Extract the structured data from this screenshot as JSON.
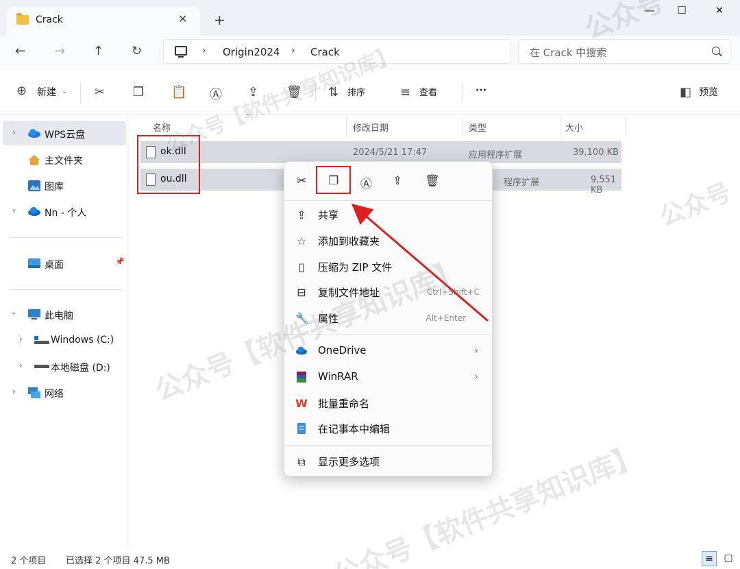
{
  "window": {
    "tab_title": "Crack",
    "tab_close": "✕",
    "new_tab": "+",
    "minimize": "—",
    "maximize": "☐",
    "close": "✕"
  },
  "nav": {
    "back": "←",
    "forward": "→",
    "up": "↑",
    "refresh": "↻"
  },
  "breadcrumb": [
    "Origin2024",
    "Crack"
  ],
  "breadcrumb_sep": "›",
  "search": {
    "placeholder": "在 Crack 中搜索"
  },
  "toolbar": {
    "new_label": "新建",
    "sort_label": "排序",
    "view_label": "查看",
    "more": "···",
    "preview_label": "预览"
  },
  "sidebar": {
    "items": [
      {
        "label": "WPS云盘",
        "icon": "cloud-icon"
      },
      {
        "label": "主文件夹",
        "icon": "home-icon"
      },
      {
        "label": "图库",
        "icon": "gallery-icon"
      },
      {
        "label": "Nn - 个人",
        "icon": "onedrive-icon"
      },
      {
        "label": "桌面",
        "icon": "desktop-icon"
      },
      {
        "label": "此电脑",
        "icon": "pc-icon"
      },
      {
        "label": "Windows (C:)",
        "icon": "drive-c-icon"
      },
      {
        "label": "本地磁盘 (D:)",
        "icon": "drive-d-icon"
      },
      {
        "label": "网络",
        "icon": "network-icon"
      }
    ]
  },
  "columns": [
    "名称",
    "修改日期",
    "类型",
    "大小"
  ],
  "files": [
    {
      "name": "ok.dll",
      "modified": "2024/5/21 17:47",
      "type": "应用程序扩展",
      "size": "39,100 KB"
    },
    {
      "name": "ou.dll",
      "modified": "",
      "type": "程序扩展",
      "size": "9,551 KB"
    }
  ],
  "status": {
    "count": "2 个项目",
    "selected": "已选择 2 个项目  47.5 MB"
  },
  "context_menu": {
    "items": [
      {
        "label": "共享",
        "icon": "share-icon",
        "shortcut": ""
      },
      {
        "label": "添加到收藏夹",
        "icon": "star-icon",
        "shortcut": ""
      },
      {
        "label": "压缩为 ZIP 文件",
        "icon": "zip-icon",
        "shortcut": ""
      },
      {
        "label": "复制文件地址",
        "icon": "copy-path-icon",
        "shortcut": "Ctrl+Shift+C"
      },
      {
        "label": "属性",
        "icon": "wrench-icon",
        "shortcut": "Alt+Enter"
      },
      {
        "label": "OneDrive",
        "icon": "onedrive-icon",
        "submenu": true
      },
      {
        "label": "WinRAR",
        "icon": "winrar-icon",
        "submenu": true
      },
      {
        "label": "批量重命名",
        "icon": "wps-icon",
        "shortcut": ""
      },
      {
        "label": "在记事本中编辑",
        "icon": "notepad-icon",
        "shortcut": ""
      },
      {
        "label": "显示更多选项",
        "icon": "more-options-icon",
        "shortcut": ""
      }
    ]
  },
  "watermark": "公众号【软件共享知识库】"
}
